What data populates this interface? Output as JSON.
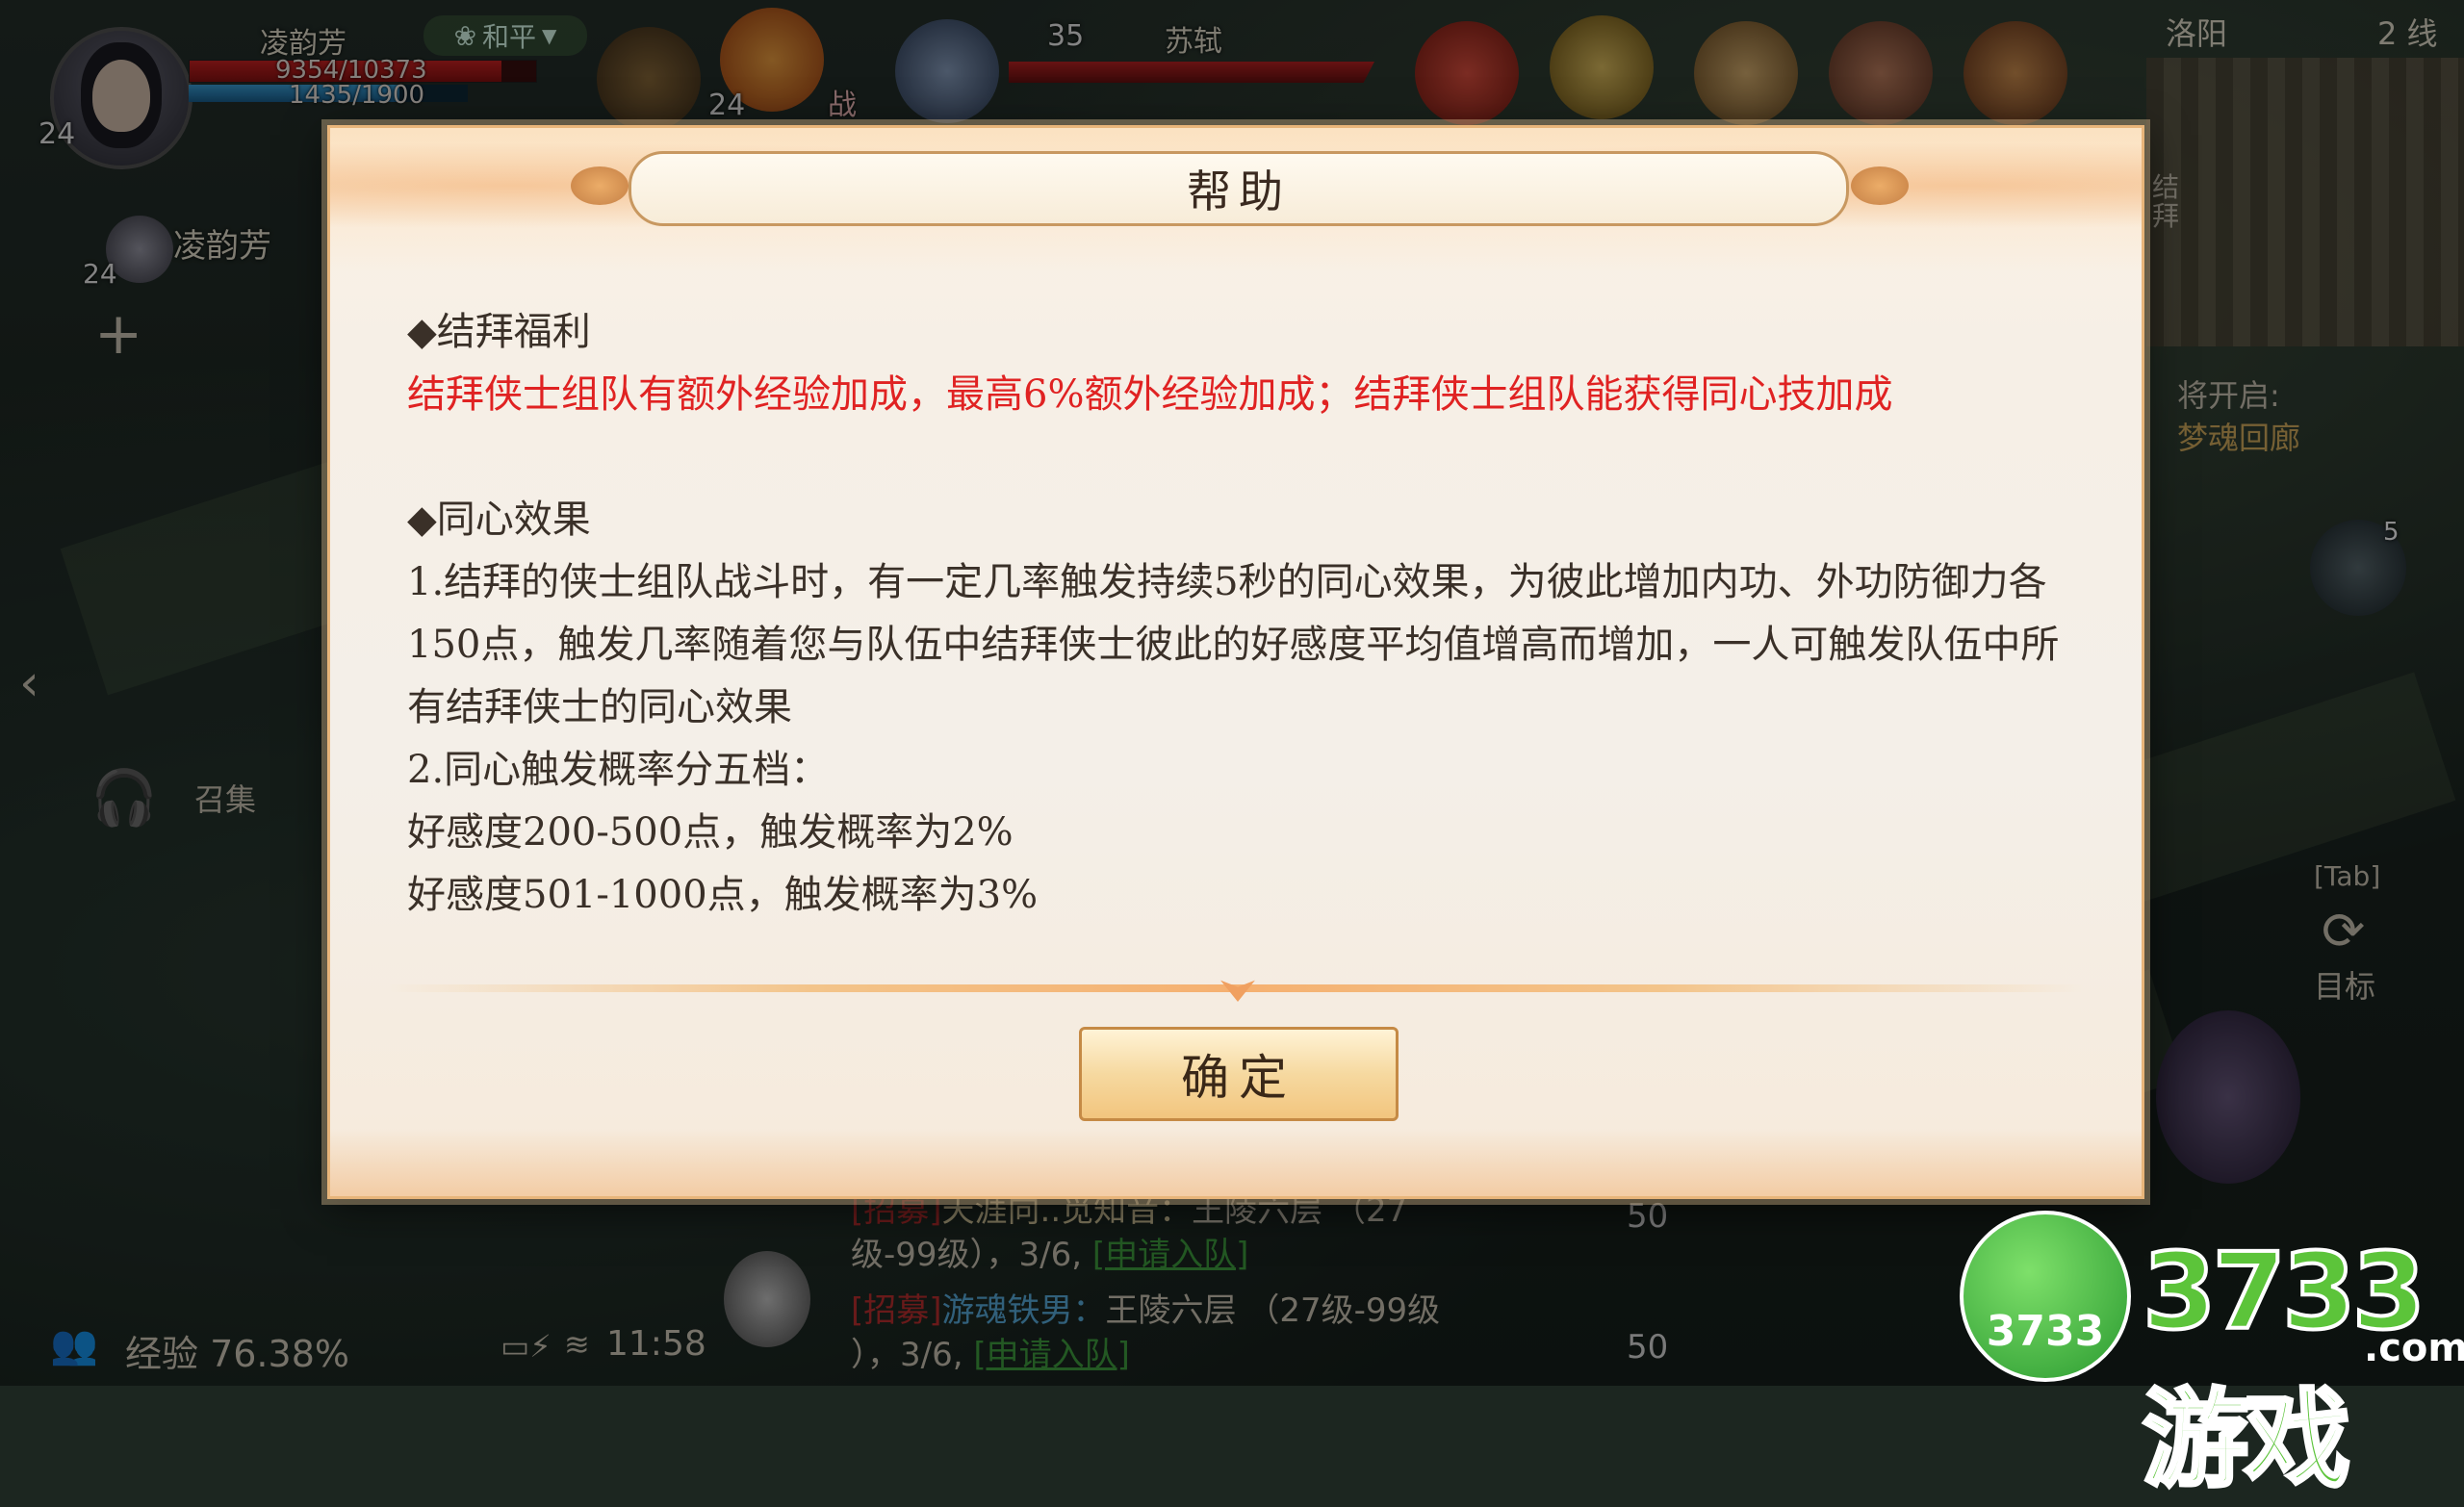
{
  "player": {
    "name": "凌韵芳",
    "level": "24",
    "mode": "和平",
    "hp": "9354/10373",
    "hp_fraction": 0.9,
    "mp": "1435/1900",
    "mp_fraction": 0.755
  },
  "skill_badge": {
    "level": "24",
    "tag": "战"
  },
  "target": {
    "level": "35",
    "name": "苏轼"
  },
  "map": {
    "city": "洛阳",
    "line": "2 线",
    "marker": "结拜"
  },
  "team": {
    "member_name": "凌韵芳",
    "member_level": "24"
  },
  "quest": {
    "label": "将开启:",
    "name": "梦魂回廊"
  },
  "right_hud": {
    "tab_key": "[Tab]",
    "target_label": "目标",
    "notice_count": "5"
  },
  "left_hud": {
    "summon_label": "召集"
  },
  "dialog": {
    "title": "帮助",
    "section1_heading": "◆结拜福利",
    "section1_text": "结拜侠士组队有额外经验加成，最高6%额外经验加成；结拜侠士组队能获得同心技加成",
    "section2_heading": "◆同心效果",
    "line1": "1.结拜的侠士组队战斗时，有一定几率触发持续5秒的同心效果，为彼此增加内功、外功防御力各150点，触发几率随着您与队伍中结拜侠士彼此的好感度平均值增高而增加，一人可触发队伍中所有结拜侠士的同心效果",
    "line2": "2.同心触发概率分五档：",
    "line3": "好感度200-500点，触发概率为2%",
    "line4": "好感度501-1000点，触发概率为3%",
    "confirm_label": "确定"
  },
  "chat": [
    {
      "tag": "[招募]",
      "name": "天涯向..觅知音：",
      "text": "王陵六层 （27",
      "text2": "级-99级），3/6,",
      "link": "[申请入队]"
    },
    {
      "tag": "[招募]",
      "name": "游魂铁男：",
      "text": "王陵六层 （27级-99级",
      "text2": "），3/6,",
      "link": "[申请入队]"
    }
  ],
  "bottom_hud": {
    "exp_label": "经验 76.38%",
    "time": "11:58",
    "count_a": "50",
    "count_b": "50"
  },
  "watermark": {
    "badge": "3733",
    "brand": "3733游戏",
    "domain": ".com"
  },
  "colors": {
    "accent_red": "#e02222",
    "dialog_border": "#e8b57a",
    "button": "#f2c57e"
  }
}
